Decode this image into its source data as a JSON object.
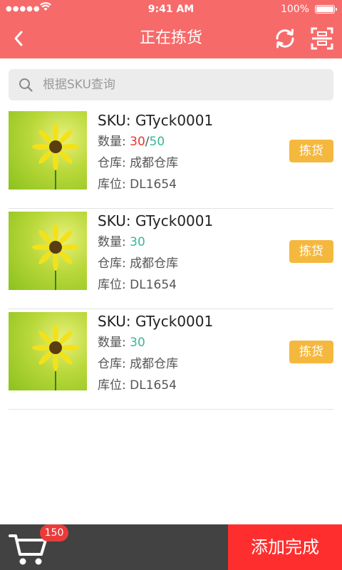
{
  "status_bar": {
    "signal": "●●●●●",
    "time": "9:41 AM",
    "battery_pct": "100%"
  },
  "nav": {
    "title": "正在拣货",
    "back_icon": "chevron-left-icon",
    "refresh_icon": "refresh-icon",
    "scan_icon": "scan-icon"
  },
  "search": {
    "placeholder": "根据SKU查询",
    "value": "",
    "icon": "search-icon"
  },
  "labels": {
    "sku": "SKU: ",
    "qty": "数量: ",
    "warehouse": "仓库: ",
    "location": "库位: ",
    "pick_button": "拣货"
  },
  "items": [
    {
      "sku": "GTyck0001",
      "qty_picked": "30",
      "qty_sep": "/",
      "qty_total": "50",
      "warehouse": "成都仓库",
      "location": "DL1654"
    },
    {
      "sku": "GTyck0001",
      "qty_picked": "",
      "qty_sep": "",
      "qty_total": "30",
      "warehouse": "成都仓库",
      "location": "DL1654"
    },
    {
      "sku": "GTyck0001",
      "qty_picked": "",
      "qty_sep": "",
      "qty_total": "30",
      "warehouse": "成都仓库",
      "location": "DL1654"
    }
  ],
  "bottom": {
    "cart_icon": "cart-icon",
    "cart_count": "150",
    "done_label": "添加完成"
  },
  "colors": {
    "header": "#f76a6a",
    "pick_button": "#f5b83e",
    "done_button": "#ff2e2e",
    "qty_picked": "#e8342f",
    "qty_total": "#35b89a",
    "cart_bar": "#424242"
  }
}
